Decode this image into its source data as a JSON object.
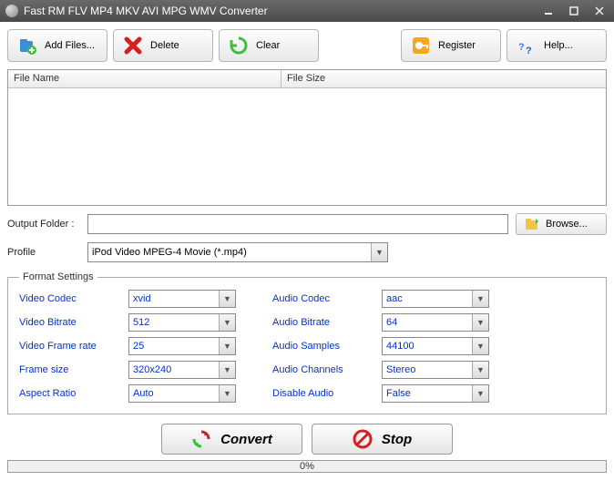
{
  "window": {
    "title": "Fast RM FLV MP4 MKV AVI MPG WMV Converter"
  },
  "toolbar": {
    "add_files": "Add Files...",
    "delete": "Delete",
    "clear": "Clear",
    "register": "Register",
    "help": "Help..."
  },
  "filelist": {
    "col_filename": "File Name",
    "col_filesize": "File Size"
  },
  "output_folder": {
    "label": "Output Folder :",
    "value": "",
    "browse": "Browse..."
  },
  "profile": {
    "label": "Profile",
    "value": "iPod Video MPEG-4 Movie (*.mp4)"
  },
  "format_settings": {
    "legend": "Format Settings",
    "video_codec": {
      "label": "Video Codec",
      "value": "xvid"
    },
    "video_bitrate": {
      "label": "Video Bitrate",
      "value": "512"
    },
    "video_frame_rate": {
      "label": "Video Frame rate",
      "value": "25"
    },
    "frame_size": {
      "label": "Frame size",
      "value": "320x240"
    },
    "aspect_ratio": {
      "label": "Aspect Ratio",
      "value": "Auto"
    },
    "audio_codec": {
      "label": "Audio Codec",
      "value": "aac"
    },
    "audio_bitrate": {
      "label": "Audio Bitrate",
      "value": "64"
    },
    "audio_samples": {
      "label": "Audio Samples",
      "value": "44100"
    },
    "audio_channels": {
      "label": "Audio Channels",
      "value": "Stereo"
    },
    "disable_audio": {
      "label": "Disable Audio",
      "value": "False"
    }
  },
  "actions": {
    "convert": "Convert",
    "stop": "Stop"
  },
  "progress": {
    "text": "0%"
  }
}
